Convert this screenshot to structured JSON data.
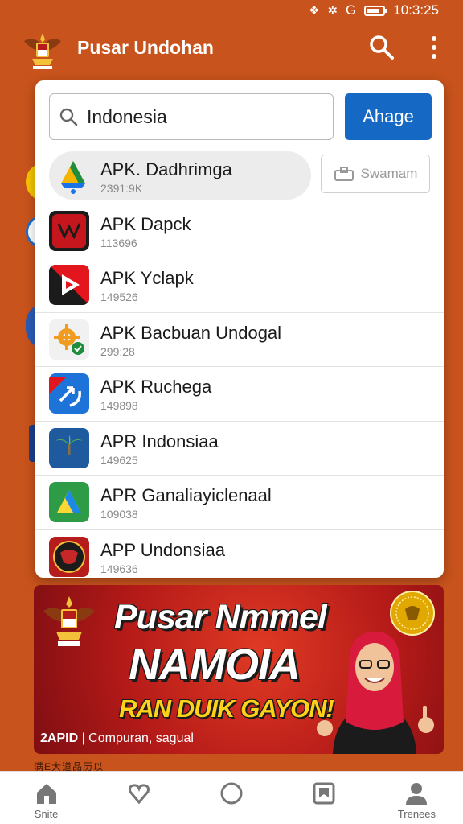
{
  "status_bar": {
    "time": "10:3:25",
    "network": "G"
  },
  "app_bar": {
    "title": "Pusar Undohan"
  },
  "search": {
    "value": "Indonesia",
    "placeholder": "Indonesia",
    "button_label": "Ahage"
  },
  "results": [
    {
      "name": "APK. Dadhrimga",
      "sub": "2391:9K",
      "highlighted": true,
      "action_label": "Swamam"
    },
    {
      "name": "APK Dapck",
      "sub": "113696"
    },
    {
      "name": "APK Yclapk",
      "sub": "149526"
    },
    {
      "name": "APK Bacbuan Undogal",
      "sub": "299:28"
    },
    {
      "name": "APK Ruchega",
      "sub": "149898"
    },
    {
      "name": "APR Indonsiaa",
      "sub": "149625"
    },
    {
      "name": "APR Ganaliayiclenaal",
      "sub": "109038"
    },
    {
      "name": "APP Undonsiaa",
      "sub": "149636"
    }
  ],
  "banner": {
    "headline_1": "Pusar Nmmel",
    "headline_2": "NAMOIA",
    "headline_3": "RAN DUIK GAYON!",
    "footer_bold": "2APID",
    "footer_text": "| Compuran, sagual",
    "below_text": "满E大道品历以"
  },
  "bottom_nav": [
    {
      "label": "Snite",
      "icon": "home-icon"
    },
    {
      "label": "",
      "icon": "heart-icon"
    },
    {
      "label": "",
      "icon": "circle-icon"
    },
    {
      "label": "",
      "icon": "bookmark-icon"
    },
    {
      "label": "Trenees",
      "icon": "person-icon"
    }
  ],
  "colors": {
    "background": "#c8531c",
    "accent": "#1668c5",
    "banner": "#b41a18"
  }
}
